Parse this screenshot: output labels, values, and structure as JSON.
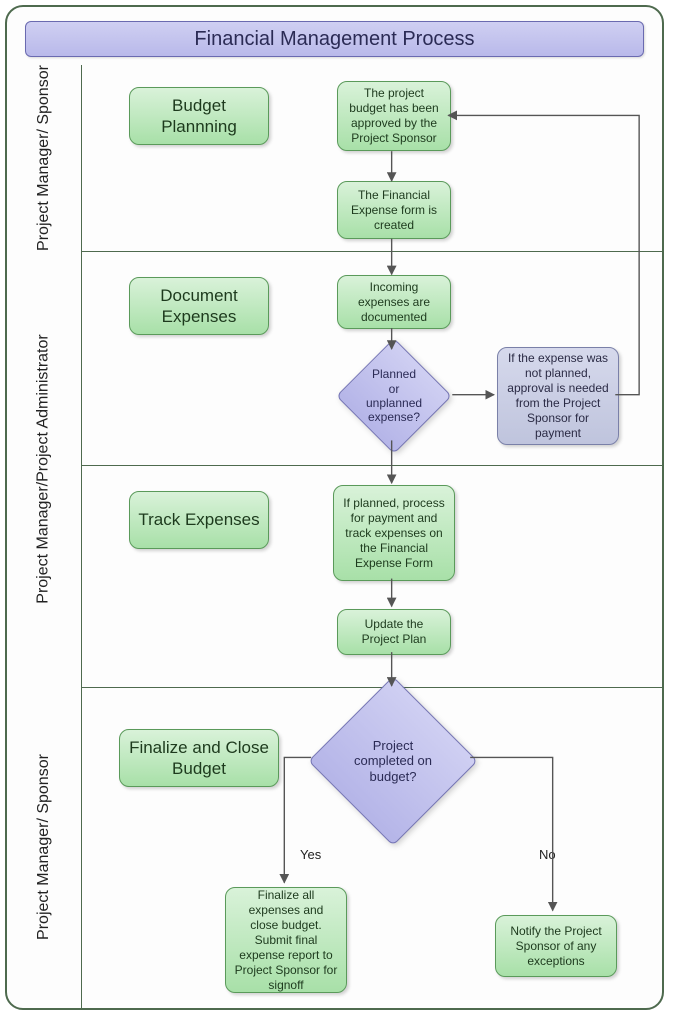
{
  "title": "Financial Management Process",
  "roles": {
    "r1": "Project Manager/ Sponsor",
    "r2": "Project Manager/Project Administrator",
    "r3": "Project Manager/ Sponsor"
  },
  "phases": {
    "p1": "Budget Plannning",
    "p2": "Document Expenses",
    "p3": "Track Expenses",
    "p4": "Finalize and Close Budget"
  },
  "steps": {
    "s1": "The project budget has been approved by the Project Sponsor",
    "s2": "The Financial Expense form is created",
    "s3": "Incoming expenses are documented",
    "s4": "If the expense was not planned, approval is needed from the Project Sponsor for payment",
    "s5": "If planned, process for payment and track expenses on the Financial Expense Form",
    "s6": "Update the Project Plan",
    "s7": "Finalize all expenses and close budget. Submit final expense report to Project Sponsor for signoff",
    "s8": "Notify the Project Sponsor of any exceptions"
  },
  "decisions": {
    "d1": "Planned or unplanned expense?",
    "d2": "Project completed on budget?"
  },
  "labels": {
    "yes": "Yes",
    "no": "No"
  }
}
